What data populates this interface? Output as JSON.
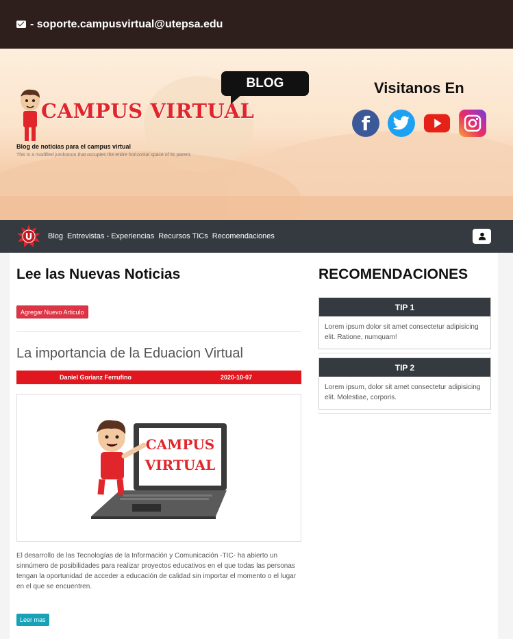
{
  "topbar": {
    "email": "- soporte.campusvirtual@utepsa.edu",
    "icon": "envelope-icon"
  },
  "jumbotron": {
    "logo_text": "CAMPUS VIRTUAL",
    "bubble_text": "BLOG",
    "subtitle": "Blog de noticias para el campus virtual",
    "description": "This is a modified jumbotron that occupies the entire horizontal space of its parent.",
    "visit_title": "Visitanos En",
    "socials": [
      "facebook-icon",
      "twitter-icon",
      "youtube-icon",
      "instagram-icon"
    ]
  },
  "navbar": {
    "logo_letter": "U",
    "items": [
      "Blog",
      "Entrevistas - Experiencias",
      "Recursos TICs",
      "Recomendaciones"
    ],
    "user_icon": "user-icon"
  },
  "news": {
    "heading": "Lee las Nuevas Noticias",
    "add_button": "Agregar Nuevo Articulo",
    "article": {
      "title": "La importancia de la Eduacion Virtual",
      "author": "Daniel Gorianz Ferrufino",
      "date": "2020-10-07",
      "image_text_1": "CAMPUS",
      "image_text_2": "VIRTUAL",
      "body": "El desarrollo de las Tecnologías de la Información y Comunicación -TIC- ha abierto un sinnúmero de posibilidades para realizar proyectos educativos en el que todas las personas tengan la oportunidad de acceder a educación de calidad sin importar el momento o el lugar en el que se encuentren.",
      "more_button": "Leer mas"
    }
  },
  "recommendations": {
    "heading": "RECOMENDACIONES",
    "tips": [
      {
        "title": "TIP 1",
        "body": "Lorem ipsum dolor sit amet consectetur adipisicing elit. Ratione, numquam!"
      },
      {
        "title": "TIP 2",
        "body": "Lorem ipsum, dolor sit amet consectetur adipisicing elit. Molestiae, corporis."
      }
    ]
  },
  "colors": {
    "accent_red": "#e0171f",
    "dark": "#343a40",
    "info": "#17a2b8",
    "danger": "#dc3545"
  }
}
